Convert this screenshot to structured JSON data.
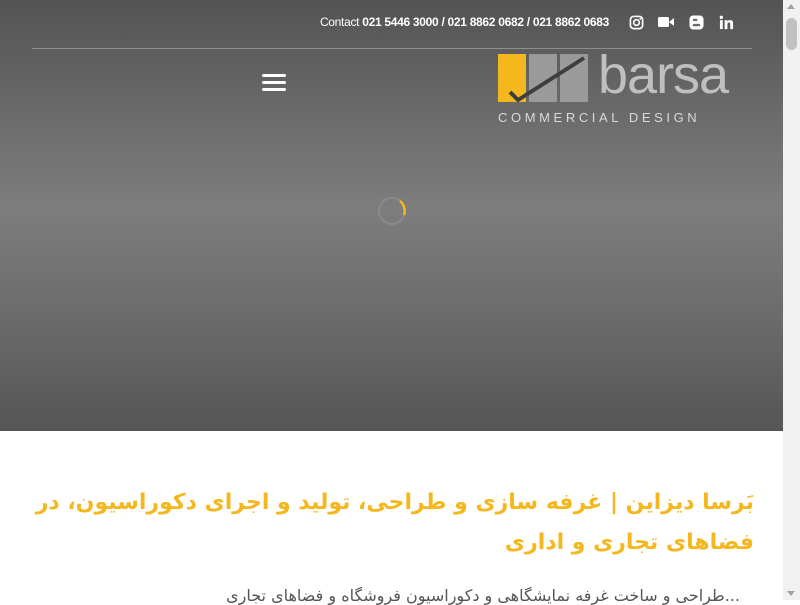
{
  "header": {
    "contact_label": "Contact",
    "phones": "021 5446 3000 / 021 8862 0682 / 021 8862 0683",
    "social_icons": [
      "instagram-icon",
      "video-icon",
      "blogger-icon",
      "linkedin-icon"
    ]
  },
  "logo": {
    "wordmark": "barsa",
    "tagline": "COMMERCIAL DESIGN"
  },
  "content": {
    "headline": "بَرسا دیزاین | غرفه سازی و طراحی، تولید و اجرای دکوراسیون، در فضاهای تجاری و اداری",
    "body_preview": "...طراحی و ساخت غرفه نمایشگاهی و دکوراسیون فروشگاه و فضاهای تجاری"
  },
  "colors": {
    "accent": "#f4b71e",
    "logo_gray": "#9a9a9a",
    "hero_gray": "#7d7d7d"
  }
}
